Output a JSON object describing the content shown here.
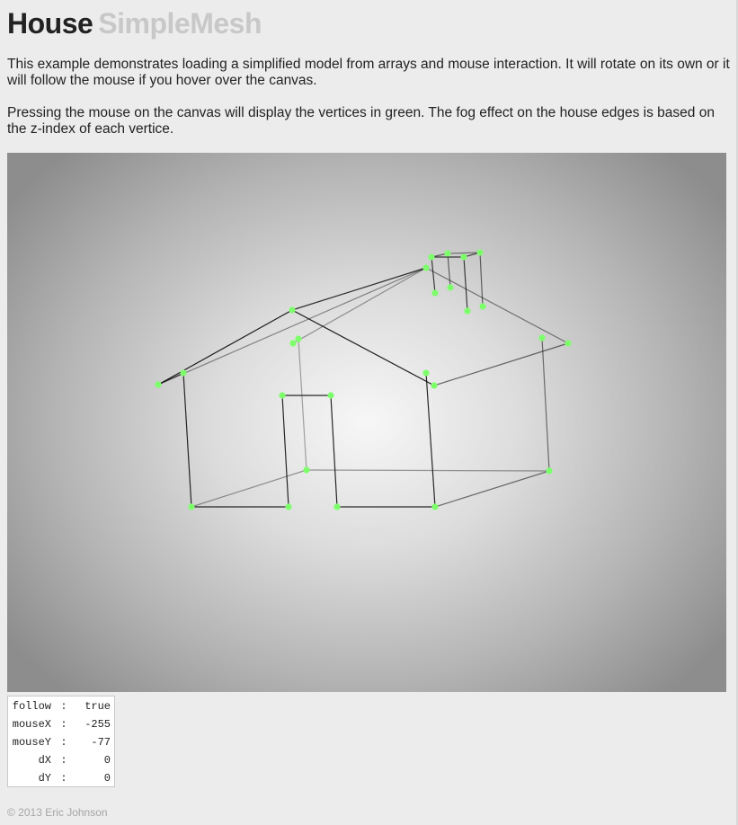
{
  "header": {
    "title_main": "House",
    "title_sub": "SimpleMesh"
  },
  "description": [
    "This example demonstrates loading a simplified model from arrays and mouse interaction. It will rotate on its own or it will follow the mouse if you hover over the canvas.",
    "Pressing the mouse on the canvas will display the vertices in green. The fog effect on the house edges is based on the z-index of each vertice."
  ],
  "canvas": {
    "vertex_color": "#7dff6b",
    "edge_color": "#111111"
  },
  "stats": [
    {
      "key": "follow",
      "sep": ":",
      "value": "true"
    },
    {
      "key": "mouseX",
      "sep": ":",
      "value": "-255"
    },
    {
      "key": "mouseY",
      "sep": ":",
      "value": "-77"
    },
    {
      "key": "dX",
      "sep": ":",
      "value": "0"
    },
    {
      "key": "dY",
      "sep": ":",
      "value": "0"
    }
  ],
  "footer": {
    "copyright": "© 2013 Eric Johnson"
  }
}
